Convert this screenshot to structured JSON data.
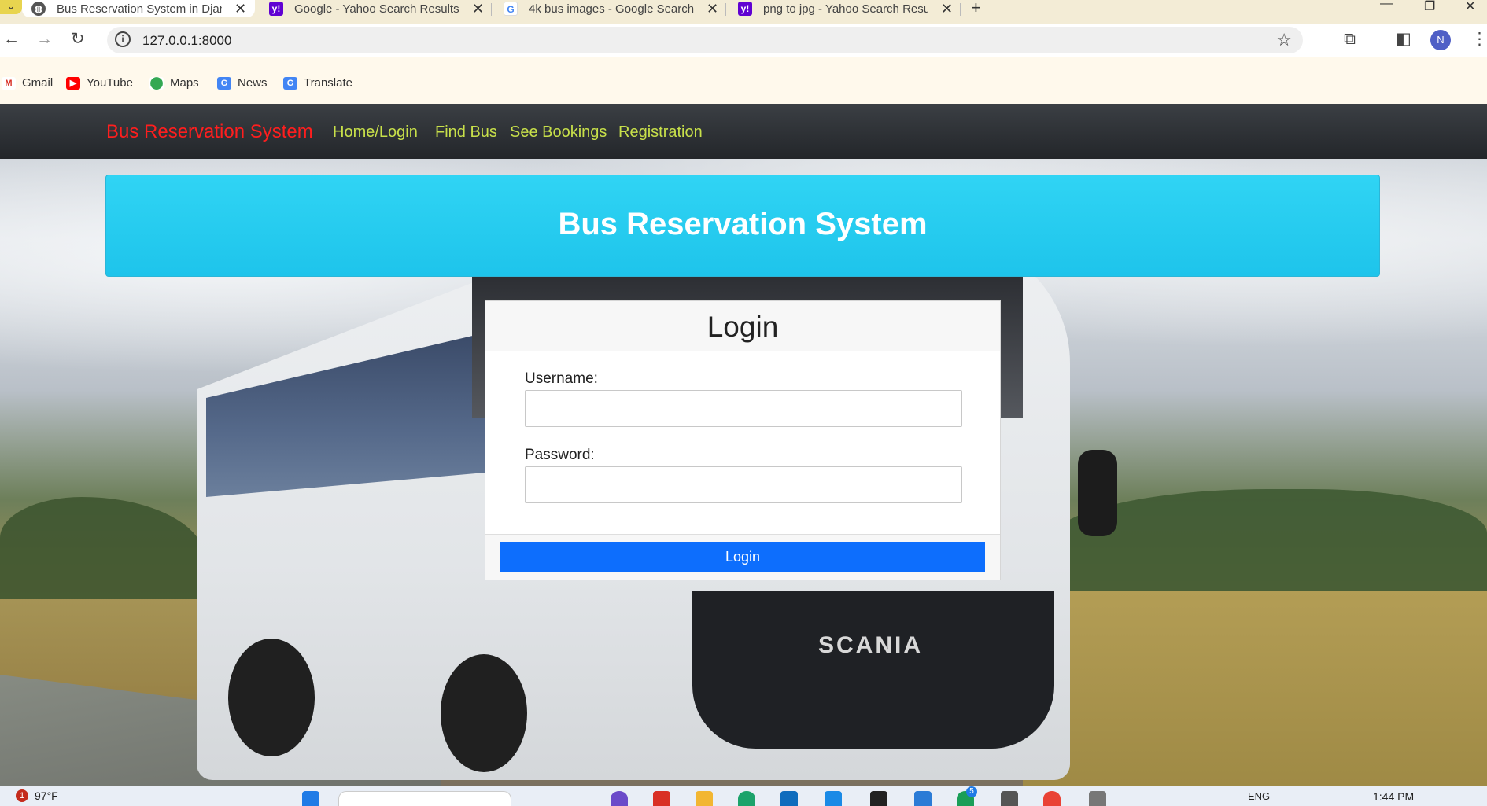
{
  "browser": {
    "tabs": [
      {
        "title": "Bus Reservation System in Djan",
        "active": true
      },
      {
        "title": "Google - Yahoo Search Results",
        "active": false
      },
      {
        "title": "4k bus images - Google Search",
        "active": false
      },
      {
        "title": "png to jpg - Yahoo Search Resu",
        "active": false
      }
    ],
    "new_tab": "+",
    "close": "✕",
    "address": "127.0.0.1:8000",
    "profile_initial": "N",
    "bookmarks": [
      "Gmail",
      "YouTube",
      "Maps",
      "News",
      "Translate"
    ]
  },
  "navbar": {
    "brand": "Bus Reservation System",
    "links": [
      "Home/Login",
      "Find Bus",
      "See Bookings",
      "Registration"
    ]
  },
  "banner": {
    "title": "Bus Reservation System"
  },
  "login": {
    "title": "Login",
    "username_label": "Username:",
    "username_value": "",
    "password_label": "Password:",
    "password_value": "",
    "submit_label": "Login"
  },
  "background": {
    "bus_brand": "SCANIA"
  },
  "taskbar": {
    "weather": "97°F",
    "notification_count": "1",
    "badge_count": "5",
    "language": "ENG",
    "time": "1:44 PM"
  },
  "colors": {
    "navbar_bg": "#23262a",
    "brand_red": "#ff1e1e",
    "nav_link": "#c8e04a",
    "banner": "#1ec4eb",
    "primary_button": "#0d6efd"
  }
}
